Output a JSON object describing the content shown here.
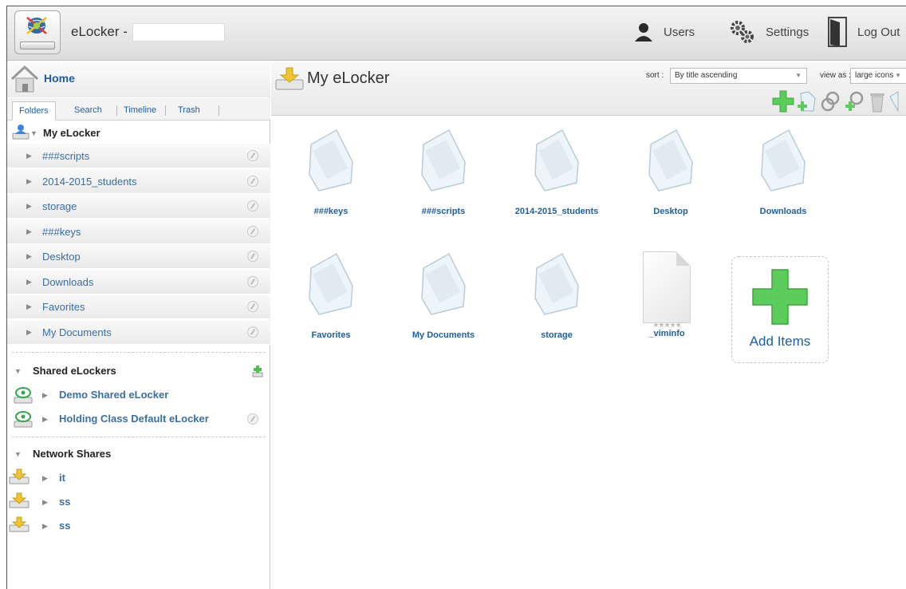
{
  "header": {
    "app_title": "eLocker -",
    "users_label": "Users",
    "settings_label": "Settings",
    "logout_label": "Log Out"
  },
  "sidebar": {
    "home_label": "Home",
    "tabs": [
      "Folders",
      "Search",
      "Timeline",
      "Trash"
    ],
    "active_tab": "Folders",
    "root_label": "My eLocker",
    "folders": [
      "###scripts",
      "2014-2015_students",
      "storage",
      "###keys",
      "Desktop",
      "Downloads",
      "Favorites",
      "My Documents"
    ],
    "shared_title": "Shared eLockers",
    "shared": [
      "Demo Shared eLocker",
      "Holding Class Default eLocker"
    ],
    "network_title": "Network Shares",
    "network": [
      "it",
      "ss",
      "ss"
    ]
  },
  "main": {
    "title": "My eLocker",
    "sort_label": "sort :",
    "sort_value": "By title ascending",
    "view_label": "view as :",
    "view_value": "large icons",
    "items_row1": [
      "###keys",
      "###scripts",
      "2014-2015_students",
      "Desktop",
      "Downloads"
    ],
    "items_row2": [
      "Favorites",
      "My Documents",
      "storage"
    ],
    "file_name": "_viminfo",
    "file_rating": "★★★★★",
    "add_label": "Add Items"
  },
  "colors": {
    "link": "#1f5fa0",
    "green_plus": "#4cc24c"
  }
}
